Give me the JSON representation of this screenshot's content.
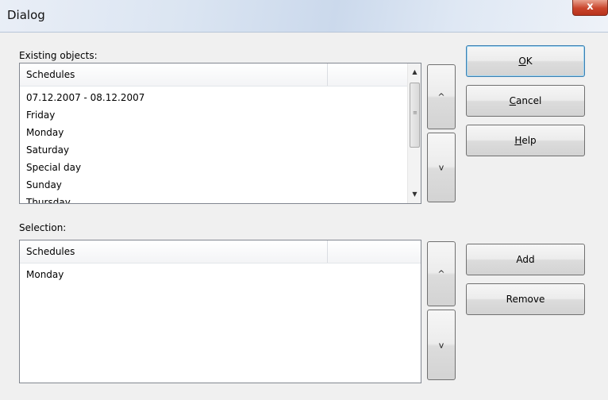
{
  "window": {
    "title": "Dialog",
    "close_label": "x"
  },
  "existing": {
    "label": "Existing objects:",
    "column_header": "Schedules",
    "items": [
      "07.12.2007 - 08.12.2007",
      "Friday",
      "Monday",
      "Saturday",
      "Special day",
      "Sunday",
      "Thursday"
    ],
    "scroll_up": "▲",
    "scroll_down": "▼",
    "grip": "≡"
  },
  "selection": {
    "label": "Selection:",
    "column_header": "Schedules",
    "items": [
      "Monday"
    ]
  },
  "move_buttons": {
    "up_label": "^",
    "down_label": "v"
  },
  "buttons": {
    "ok": {
      "mnemonic": "O",
      "rest": "K"
    },
    "cancel": {
      "mnemonic": "C",
      "rest": "ancel"
    },
    "help": {
      "mnemonic": "H",
      "rest": "elp"
    },
    "add": "Add",
    "remove": "Remove"
  }
}
